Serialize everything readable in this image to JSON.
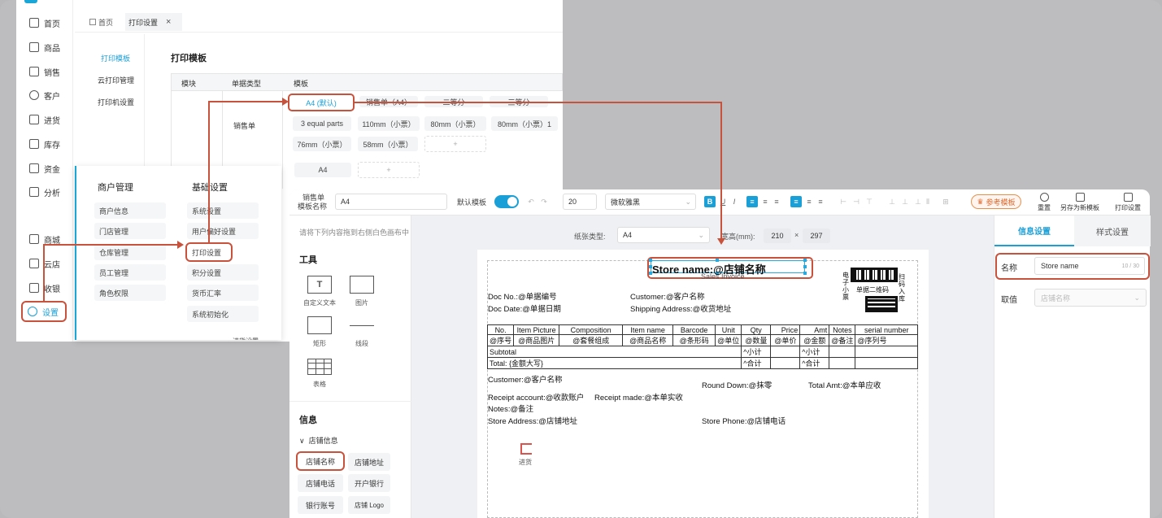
{
  "sidebar": {
    "items": [
      {
        "label": "首页",
        "icon": "home-icon"
      },
      {
        "label": "商品",
        "icon": "box-icon"
      },
      {
        "label": "销售",
        "icon": "receipt-icon"
      },
      {
        "label": "客户",
        "icon": "user-icon"
      },
      {
        "label": "进货",
        "icon": "inbound-icon"
      },
      {
        "label": "库存",
        "icon": "warehouse-icon"
      },
      {
        "label": "资金",
        "icon": "wallet-icon"
      },
      {
        "label": "分析",
        "icon": "chart-icon"
      },
      {
        "label": "商城",
        "icon": "mall-icon"
      },
      {
        "label": "云店",
        "icon": "store-icon"
      },
      {
        "label": "收银",
        "icon": "cashier-icon"
      },
      {
        "label": "设置",
        "icon": "gear-icon"
      }
    ]
  },
  "tabs": {
    "home": "首页",
    "current": "打印设置",
    "close": "×"
  },
  "settings_nav": {
    "items": [
      "打印模板",
      "云打印管理",
      "打印机设置"
    ]
  },
  "template_panel": {
    "title": "打印模板",
    "headers": [
      "模块",
      "单据类型",
      "模板"
    ],
    "doc_type": "销售单",
    "row1": [
      "A4 (默认)",
      "销售单（A4）",
      "二等分",
      "三等分"
    ],
    "row2": [
      "3 equal parts",
      "110mm（小票）",
      "80mm（小票）",
      "80mm（小票）1"
    ],
    "row3": [
      "76mm（小票）",
      "58mm（小票）",
      "+"
    ],
    "row4": [
      "A4",
      "+"
    ]
  },
  "menu": {
    "col1_title": "商户管理",
    "col1": [
      "商户信息",
      "门店管理",
      "仓库管理",
      "员工管理",
      "角色权限"
    ],
    "col2_title": "基础设置",
    "col2": [
      "系统设置",
      "用户偏好设置",
      "打印设置",
      "积分设置",
      "货币汇率",
      "系统初始化"
    ],
    "extra": "进货设置"
  },
  "editor": {
    "toolbar": {
      "tpl_label_1": "销售单",
      "tpl_label_2": "模板名称",
      "tpl_name": "A4",
      "default_label": "默认模板",
      "font_size": "20",
      "font_family": "微软雅黑",
      "bold": "B",
      "underline": "U",
      "italic": "I",
      "ref_button": "参考模板",
      "actions": [
        "重置",
        "另存为新模板",
        "打印设置"
      ]
    },
    "palette": {
      "tip": "请将下列内容拖到右侧白色画布中",
      "tools_title": "工具",
      "tools": [
        "自定义文本",
        "图片",
        "矩形",
        "线段",
        "表格"
      ],
      "info_title": "信息",
      "group": "店铺信息",
      "tags": [
        "店铺名称",
        "店铺地址",
        "店铺电话",
        "开户银行",
        "银行账号",
        "店铺 Logo"
      ]
    },
    "paper_bar": {
      "type_label": "纸张类型:",
      "type_value": "A4",
      "size_label": "宽高(mm):",
      "width": "210",
      "x": "×",
      "height": "297"
    },
    "doc": {
      "store_name": "Store name:@店铺名称",
      "subtitle": "Sales Invoice",
      "doc_no": "Doc No.:@单据编号",
      "doc_date": "Doc Date:@单据日期",
      "customer": "Customer:@客户名称",
      "shipping": "Shipping Address:@收货地址",
      "qr_left": "电子小票",
      "qr_mid": "单据二维码",
      "qr_right": "扫码入库",
      "table_headers": [
        "No.",
        "Item Picture",
        "Composition",
        "Item name",
        "Barcode",
        "Unit",
        "Qty",
        "Price",
        "Amt",
        "Notes",
        "serial number"
      ],
      "table_row": [
        "@序号",
        "@商品图片",
        "@套餐组成",
        "@商品名称",
        "@条形码",
        "@单位",
        "@数量",
        "@单价",
        "@金额",
        "@备注",
        "@序列号"
      ],
      "subtotal_label": "Subtotal",
      "subtotal_qty": "^小计",
      "subtotal_amt": "^小计",
      "total_label": "Total: {金额大写}",
      "total_qty": "^合计",
      "total_amt": "^合计",
      "footer_customer": "Customer:@客户名称",
      "round_down": "Round Down:@抹零",
      "total_amt_due": "Total Amt:@本单应收",
      "receipt_account": "Receipt account:@收款账户",
      "receipt_made": "Receipt made:@本单实收",
      "notes": "Notes:@备注",
      "store_address": "Store Address:@店铺地址",
      "store_phone": "Store Phone:@店铺电话",
      "stamp": "进货"
    },
    "right_panel": {
      "tab_info": "信息设置",
      "tab_style": "样式设置",
      "name_label": "名称",
      "name_value": "Store name",
      "name_count": "10 / 30",
      "value_label": "取值",
      "value_placeholder": "店铺名称"
    }
  },
  "colors": {
    "accent": "#1a9fd6",
    "highlight": "#c9523c",
    "ref": "#e06a2e"
  }
}
